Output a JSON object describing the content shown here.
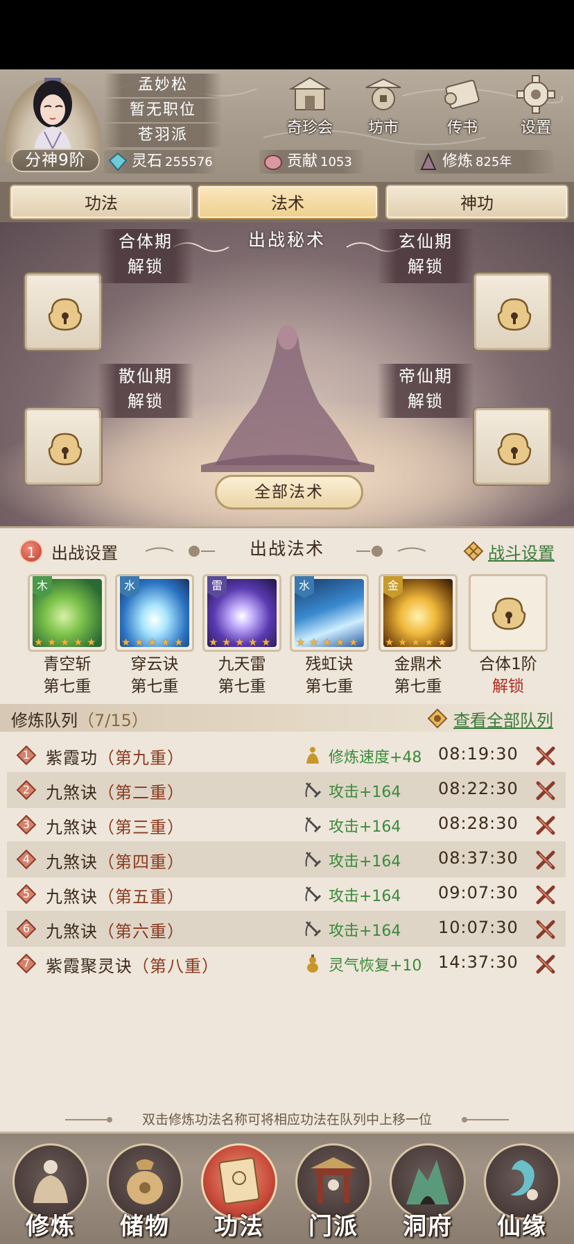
{
  "header": {
    "rank": "分神9阶",
    "name": "孟妙松",
    "position": "暂无职位",
    "sect": "苍羽派",
    "buttons": [
      {
        "label": "奇珍会",
        "icon": "treasure-pavilion-icon"
      },
      {
        "label": "坊市",
        "icon": "market-icon"
      },
      {
        "label": "传书",
        "icon": "scroll-letter-icon"
      },
      {
        "label": "设置",
        "icon": "gear-icon"
      }
    ],
    "resources": [
      {
        "label": "灵石",
        "value": "255576",
        "icon": "spirit-stone-icon"
      },
      {
        "label": "贡献",
        "value": "1053",
        "icon": "contribution-icon"
      },
      {
        "label": "修炼",
        "value": "825年",
        "icon": "cultivation-icon"
      }
    ]
  },
  "tabs": [
    {
      "label": "功法",
      "active": false
    },
    {
      "label": "法术",
      "active": true
    },
    {
      "label": "神功",
      "active": false
    }
  ],
  "hero": {
    "title": "出战秘术",
    "slots": [
      {
        "stage": "合体期",
        "status": "解锁"
      },
      {
        "stage": "玄仙期",
        "status": "解锁"
      },
      {
        "stage": "散仙期",
        "status": "解锁"
      },
      {
        "stage": "帝仙期",
        "status": "解锁"
      }
    ],
    "all_button": "全部法术"
  },
  "battle": {
    "badge": "1",
    "settings_label": "出战设置",
    "title": "出战法术",
    "fight_settings": "战斗设置",
    "skills": [
      {
        "element": "木",
        "name": "青空斩",
        "level": "第七重",
        "stars": 5,
        "color": "#4a9a4a"
      },
      {
        "element": "水",
        "name": "穿云诀",
        "level": "第七重",
        "stars": 5,
        "color": "#3a7ab0"
      },
      {
        "element": "雷",
        "name": "九天雷",
        "level": "第七重",
        "stars": 5,
        "color": "#5a4a9a"
      },
      {
        "element": "水",
        "name": "残虹诀",
        "level": "第七重",
        "stars": 5,
        "color": "#3a7ab0"
      },
      {
        "element": "金",
        "name": "金鼎术",
        "level": "第七重",
        "stars": 5,
        "color": "#c89a2a"
      },
      {
        "element": "",
        "name": "合体1阶",
        "level": "解锁",
        "stars": 0,
        "color": ""
      }
    ]
  },
  "queue": {
    "title": "修炼队列",
    "count": "（7/15）",
    "view_all": "查看全部队列",
    "rows": [
      {
        "num": "1",
        "name": "紫霞功",
        "layer": "（第九重）",
        "effect": "修炼速度+48",
        "effect_icon": "meditation-icon",
        "time": "08:19:30"
      },
      {
        "num": "2",
        "name": "九煞诀",
        "layer": "（第二重）",
        "effect": "攻击+164",
        "effect_icon": "sword-icon",
        "time": "08:22:30"
      },
      {
        "num": "3",
        "name": "九煞诀",
        "layer": "（第三重）",
        "effect": "攻击+164",
        "effect_icon": "sword-icon",
        "time": "08:28:30"
      },
      {
        "num": "4",
        "name": "九煞诀",
        "layer": "（第四重）",
        "effect": "攻击+164",
        "effect_icon": "sword-icon",
        "time": "08:37:30"
      },
      {
        "num": "5",
        "name": "九煞诀",
        "layer": "（第五重）",
        "effect": "攻击+164",
        "effect_icon": "sword-icon",
        "time": "09:07:30"
      },
      {
        "num": "6",
        "name": "九煞诀",
        "layer": "（第六重）",
        "effect": "攻击+164",
        "effect_icon": "sword-icon",
        "time": "10:07:30"
      },
      {
        "num": "7",
        "name": "紫霞聚灵诀",
        "layer": "（第八重）",
        "effect": "灵气恢复+10",
        "effect_icon": "gourd-icon",
        "time": "14:37:30"
      }
    ],
    "hint": "双击修炼功法名称可将相应功法在队列中上移一位"
  },
  "nav": [
    {
      "label": "修炼",
      "icon": "cultivate-icon",
      "active": false
    },
    {
      "label": "储物",
      "icon": "storage-bag-icon",
      "active": false
    },
    {
      "label": "功法",
      "icon": "scroll-icon",
      "active": true
    },
    {
      "label": "门派",
      "icon": "sect-gate-icon",
      "active": false
    },
    {
      "label": "洞府",
      "icon": "cave-icon",
      "active": false
    },
    {
      "label": "仙缘",
      "icon": "immortal-fate-icon",
      "active": false
    }
  ]
}
